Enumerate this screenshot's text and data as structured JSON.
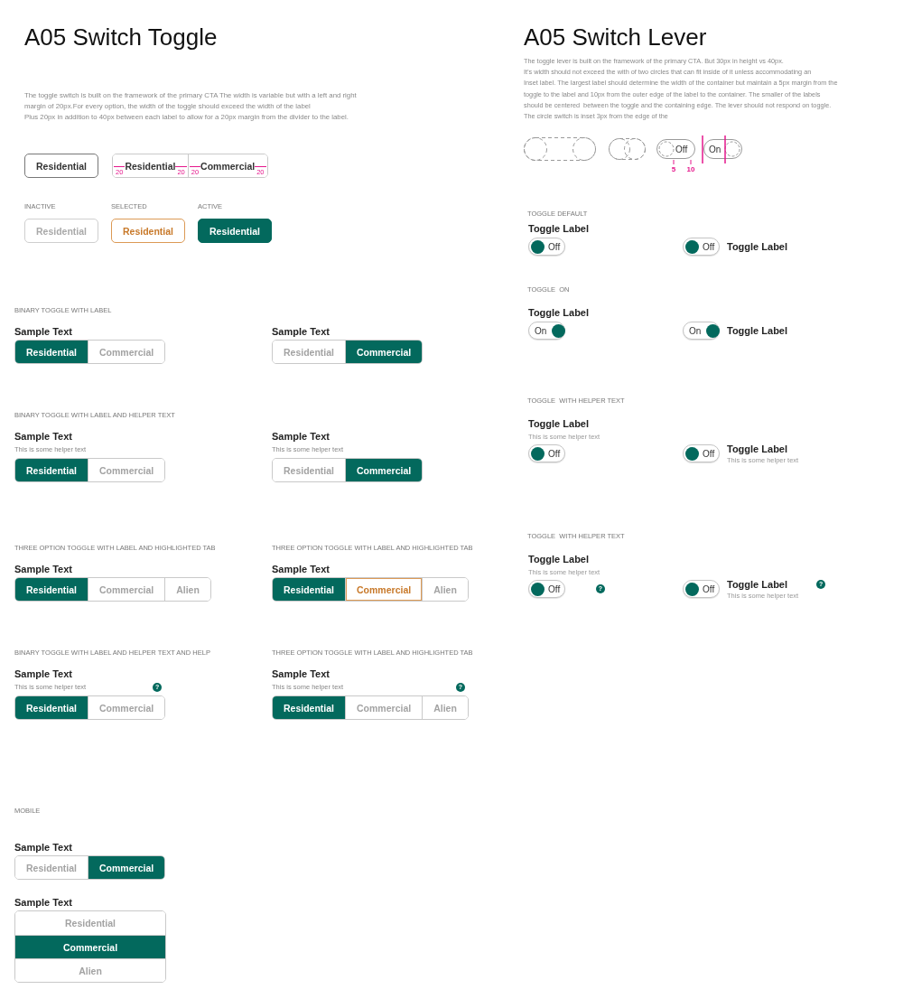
{
  "toggle_panel": {
    "title": "A05 Switch Toggle",
    "description": "The toggle switch is built on the framework of the primary CTA The width is variable but with a left and right\nmargin of 20px.For every option, the width of the toggle should exceed the width of the label\nPlus 20px in addition to 40px between each label to allow for a 20px margin from the divider to the label.",
    "anatomy": {
      "single_button": "Residential",
      "segments": [
        {
          "label": "Residential",
          "margins": [
            "20",
            "20"
          ]
        },
        {
          "label": "Commercial",
          "margins": [
            "20",
            "20"
          ]
        }
      ]
    },
    "states": [
      {
        "caption": "INACTIVE",
        "label": "Residential",
        "selected": false,
        "highlighted": false
      },
      {
        "caption": "SELECTED",
        "label": "Residential",
        "selected": false,
        "highlighted": true
      },
      {
        "caption": "ACTIVE",
        "label": "Residential",
        "selected": true,
        "highlighted": false
      }
    ],
    "sections": [
      {
        "heading": "BINARY TOGGLE WITH LABEL",
        "kind": "columns",
        "examples": [
          {
            "label": "Sample Text",
            "kind": "horizontal",
            "options": [
              {
                "label": "Residential",
                "selected": true,
                "highlighted": false
              },
              {
                "label": "Commercial",
                "selected": false,
                "highlighted": false
              }
            ]
          },
          {
            "label": "Sample Text",
            "kind": "horizontal",
            "options": [
              {
                "label": "Residential",
                "selected": false,
                "highlighted": false
              },
              {
                "label": "Commercial",
                "selected": true,
                "highlighted": false
              }
            ]
          }
        ]
      },
      {
        "heading": "BINARY TOGGLE WITH LABEL AND HELPER TEXT",
        "kind": "columns",
        "examples": [
          {
            "label": "Sample Text",
            "helper": "This is some helper text",
            "kind": "horizontal",
            "options": [
              {
                "label": "Residential",
                "selected": true,
                "highlighted": false
              },
              {
                "label": "Commercial",
                "selected": false,
                "highlighted": false
              }
            ]
          },
          {
            "label": "Sample Text",
            "helper": "This is some helper text",
            "kind": "horizontal",
            "options": [
              {
                "label": "Residential",
                "selected": false,
                "highlighted": false
              },
              {
                "label": "Commercial",
                "selected": true,
                "highlighted": false
              }
            ]
          }
        ]
      },
      {
        "heading": "THREE OPTION TOGGLE WITH LABEL AND HIGHLIGHTED TAB",
        "kind": "stack",
        "examples": [
          {
            "label": "Sample Text",
            "kind": "horizontal",
            "options": [
              {
                "label": "Residential",
                "selected": true,
                "highlighted": false
              },
              {
                "label": "Commercial",
                "selected": false,
                "highlighted": false
              },
              {
                "label": "Alien",
                "selected": false,
                "highlighted": false
              }
            ]
          }
        ]
      },
      {
        "heading": "THREE OPTION TOGGLE WITH LABEL AND HIGHLIGHTED TAB",
        "kind": "stack",
        "examples": [
          {
            "label": "Sample Text",
            "kind": "horizontal",
            "options": [
              {
                "label": "Residential",
                "selected": true,
                "highlighted": false
              },
              {
                "label": "Commercial",
                "selected": false,
                "highlighted": true
              },
              {
                "label": "Alien",
                "selected": false,
                "highlighted": false
              }
            ]
          }
        ]
      },
      {
        "heading": "BINARY TOGGLE WITH LABEL AND HELPER TEXT AND HELP",
        "kind": "stack",
        "examples": [
          {
            "label": "Sample Text",
            "helper": "This is some helper text",
            "help": "?",
            "kind": "horizontal",
            "options": [
              {
                "label": "Residential",
                "selected": true,
                "highlighted": false
              },
              {
                "label": "Commercial",
                "selected": false,
                "highlighted": false
              }
            ]
          }
        ]
      },
      {
        "heading": "THREE OPTION TOGGLE WITH LABEL AND HIGHLIGHTED TAB",
        "kind": "stack",
        "examples": [
          {
            "label": "Sample Text",
            "helper": "This is some helper text",
            "help": "?",
            "kind": "horizontal",
            "options": [
              {
                "label": "Residential",
                "selected": true,
                "highlighted": false
              },
              {
                "label": "Commercial",
                "selected": false,
                "highlighted": false
              },
              {
                "label": "Alien",
                "selected": false,
                "highlighted": false
              }
            ]
          }
        ]
      },
      {
        "heading": "MOBILE",
        "kind": "stack",
        "examples": [
          {
            "label": "Sample Text",
            "kind": "horizontal",
            "options": [
              {
                "label": "Residential",
                "selected": false,
                "highlighted": false
              },
              {
                "label": "Commercial",
                "selected": true,
                "highlighted": false
              }
            ]
          },
          {
            "label": "Sample Text",
            "kind": "vertical",
            "options": [
              {
                "label": "Residential",
                "selected": false,
                "highlighted": false
              },
              {
                "label": "Commercial",
                "selected": true,
                "highlighted": false
              },
              {
                "label": "Alien",
                "selected": false,
                "highlighted": false
              }
            ]
          }
        ]
      }
    ]
  },
  "lever_panel": {
    "title": "A05 Switch Lever",
    "description": "The toggle lever is built on the framework of the primary CTA. But 30px in height vs 40px.\nIt’s width should not exceed the with of two circles that can fit inside of it unless accommodating an\nInset label. The largest label should determine the width of the container but maintain a 5px margin from the\ntoggle to the label and 10px from the outer edge of the label to the container. The smaller of the labels\nshould be centered  between the toggle and the containing edge. The lever should not respond on toggle.\nThe circle switch is inset 3px from the edge of the",
    "anatomy": {
      "levers": [
        {
          "text": "Off",
          "on": false,
          "marks": [
            "5",
            "10"
          ]
        },
        {
          "text": "On",
          "on": true,
          "guide_lines": true
        }
      ]
    },
    "sections": [
      {
        "heading": "TOGGLE DEFAULT",
        "examples": [
          {
            "label": "Toggle Label",
            "kind": "stacked",
            "switch": {
              "on": false,
              "text": "Off"
            }
          },
          {
            "label": "Toggle Label",
            "kind": "inline",
            "switch": {
              "on": false,
              "text": "Off"
            }
          }
        ]
      },
      {
        "heading": "TOGGLE  ON",
        "examples": [
          {
            "label": "Toggle Label",
            "kind": "stacked",
            "switch": {
              "on": true,
              "text": "On"
            }
          },
          {
            "label": "Toggle Label",
            "kind": "inline",
            "switch": {
              "on": true,
              "text": "On"
            }
          }
        ]
      },
      {
        "heading": "TOGGLE  WITH HELPER TEXT",
        "examples": [
          {
            "label": "Toggle Label",
            "helper": "This is some helper text",
            "kind": "stacked",
            "switch": {
              "on": false,
              "text": "Off"
            }
          },
          {
            "label": "Toggle Label",
            "helper": "This is some helper text",
            "kind": "inline",
            "switch": {
              "on": false,
              "text": "Off"
            }
          }
        ]
      },
      {
        "heading": "TOGGLE  WITH HELPER TEXT",
        "examples": [
          {
            "label": "Toggle Label",
            "helper": "This is some helper text",
            "help": "?",
            "kind": "stacked",
            "switch": {
              "on": false,
              "text": "Off"
            }
          },
          {
            "label": "Toggle Label",
            "helper": "This is some helper text",
            "help": "?",
            "kind": "inline",
            "switch": {
              "on": false,
              "text": "Off"
            }
          }
        ]
      }
    ]
  }
}
